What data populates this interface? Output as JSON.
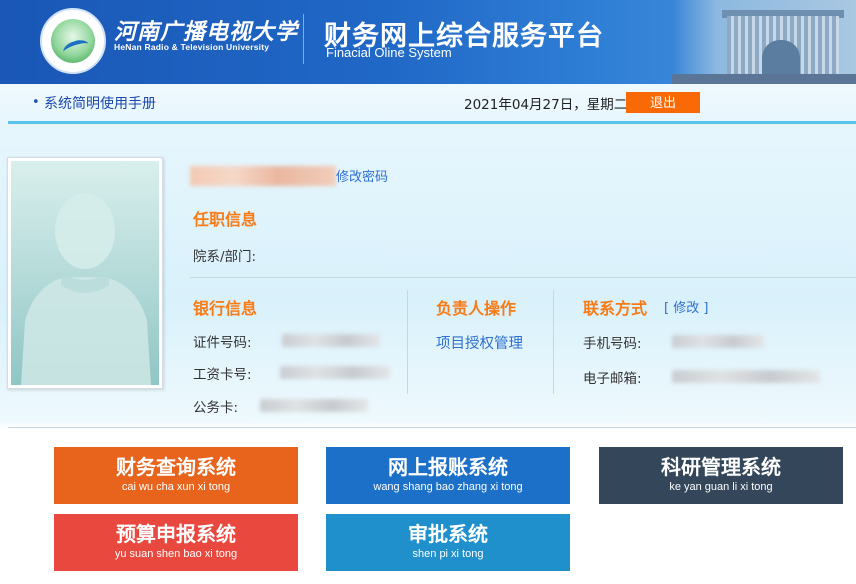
{
  "header": {
    "university_cn": "河南广播电视大学",
    "university_en": "HeNan Radio & Television University",
    "system_title_cn": "财务网上综合服务平台",
    "system_title_en": "Finacial Oline System",
    "logo_icon": "university-seal-icon"
  },
  "toolbar": {
    "manual_link": "系统简明使用手册",
    "date": "2021年04月27日，星期二",
    "logout_label": "退出",
    "logout_color": "#f96a06"
  },
  "profile": {
    "change_password": "修改密码",
    "job_section": {
      "title": "任职信息",
      "department_label": "院系/部门:"
    },
    "bank_section": {
      "title": "银行信息",
      "id_label": "证件号码:",
      "salary_card_label": "工资卡号:",
      "official_card_label": "公务卡:"
    },
    "manager_section": {
      "title": "负责人操作",
      "project_auth": "项目授权管理"
    },
    "contact_section": {
      "title": "联系方式",
      "edit_label": "[ 修改 ]",
      "phone_label": "手机号码:",
      "email_label": "电子邮箱:"
    }
  },
  "systems": [
    {
      "name": "财务查询系统",
      "pinyin": "cai wu cha xun xi tong",
      "color": "#e8641d"
    },
    {
      "name": "网上报账系统",
      "pinyin": "wang shang bao zhang xi tong",
      "color": "#1d70c8"
    },
    {
      "name": "科研管理系统",
      "pinyin": "ke yan guan li xi tong",
      "color": "#33465a"
    },
    {
      "name": "预算申报系统",
      "pinyin": "yu suan shen bao xi tong",
      "color": "#e8483e"
    },
    {
      "name": "审批系统",
      "pinyin": "shen pi xi tong",
      "color": "#1f90cc"
    }
  ],
  "accent_colors": {
    "section_title": "#f97b16",
    "link": "#2d6fd1",
    "header_blue": "#1a57b6"
  }
}
